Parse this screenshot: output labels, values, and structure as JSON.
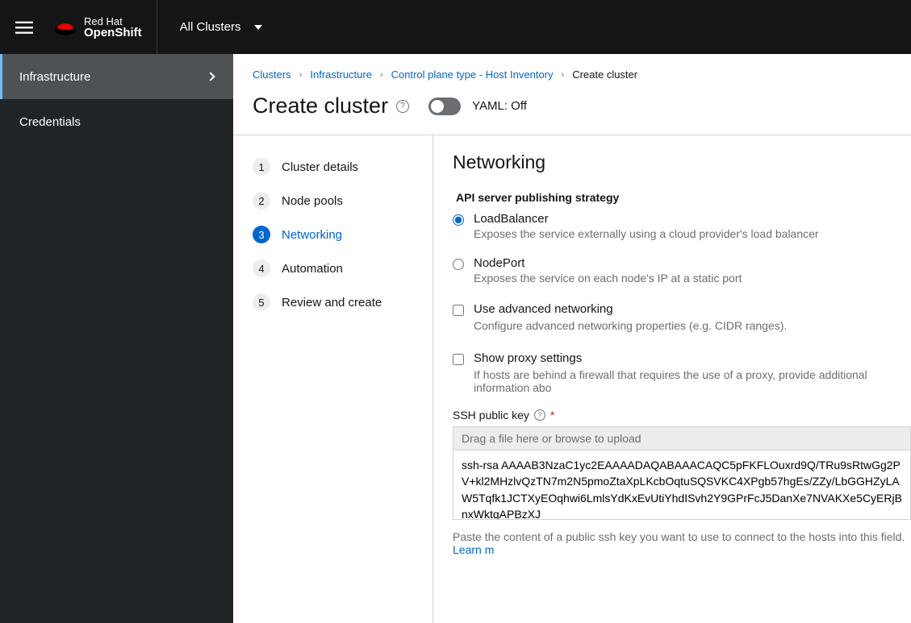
{
  "header": {
    "brand_top": "Red Hat",
    "brand_bottom": "OpenShift",
    "cluster_selector": "All Clusters"
  },
  "sidebar": {
    "items": [
      {
        "label": "Infrastructure",
        "active": true,
        "expandable": true
      },
      {
        "label": "Credentials",
        "active": false,
        "expandable": false
      }
    ]
  },
  "breadcrumb": {
    "items": [
      {
        "label": "Clusters",
        "link": true
      },
      {
        "label": "Infrastructure",
        "link": true
      },
      {
        "label": "Control plane type - Host Inventory",
        "link": true
      },
      {
        "label": "Create cluster",
        "link": false
      }
    ]
  },
  "page": {
    "title": "Create cluster",
    "yaml_label": "YAML: Off"
  },
  "wizard": {
    "steps": [
      {
        "num": "1",
        "label": "Cluster details"
      },
      {
        "num": "2",
        "label": "Node pools"
      },
      {
        "num": "3",
        "label": "Networking"
      },
      {
        "num": "4",
        "label": "Automation"
      },
      {
        "num": "5",
        "label": "Review and create"
      }
    ],
    "active_index": 2
  },
  "form": {
    "section_title": "Networking",
    "api_strategy_label": "API server publishing strategy",
    "radios": [
      {
        "value": "LoadBalancer",
        "desc": "Exposes the service externally using a cloud provider's load balancer",
        "checked": true
      },
      {
        "value": "NodePort",
        "desc": "Exposes the service on each node's IP at a static port",
        "checked": false
      }
    ],
    "adv_net": {
      "label": "Use advanced networking",
      "desc": "Configure advanced networking properties (e.g. CIDR ranges)."
    },
    "proxy": {
      "label": "Show proxy settings",
      "desc": "If hosts are behind a firewall that requires the use of a proxy, provide additional information abo"
    },
    "ssh": {
      "label": "SSH public key",
      "dropzone": "Drag a file here or browse to upload",
      "value": "ssh-rsa AAAAB3NzaC1yc2EAAAADAQABAAACAQC5pFKFLOuxrd9Q/TRu9sRtwGg2PV+kl2MHzlvQzTN7m2N5pmoZtaXpLKcbOqtuSQSVKC4XPgb57hgEs/ZZy/LbGGHZyLAW5Tqfk1JCTXyEOqhwi6LmlsYdKxEvUtiYhdISvh2Y9GPrFcJ5DanXe7NVAKXe5CyERjBnxWktqAPBzXJ",
      "hint": "Paste the content of a public ssh key you want to use to connect to the hosts into this field. ",
      "learn": "Learn m"
    }
  }
}
